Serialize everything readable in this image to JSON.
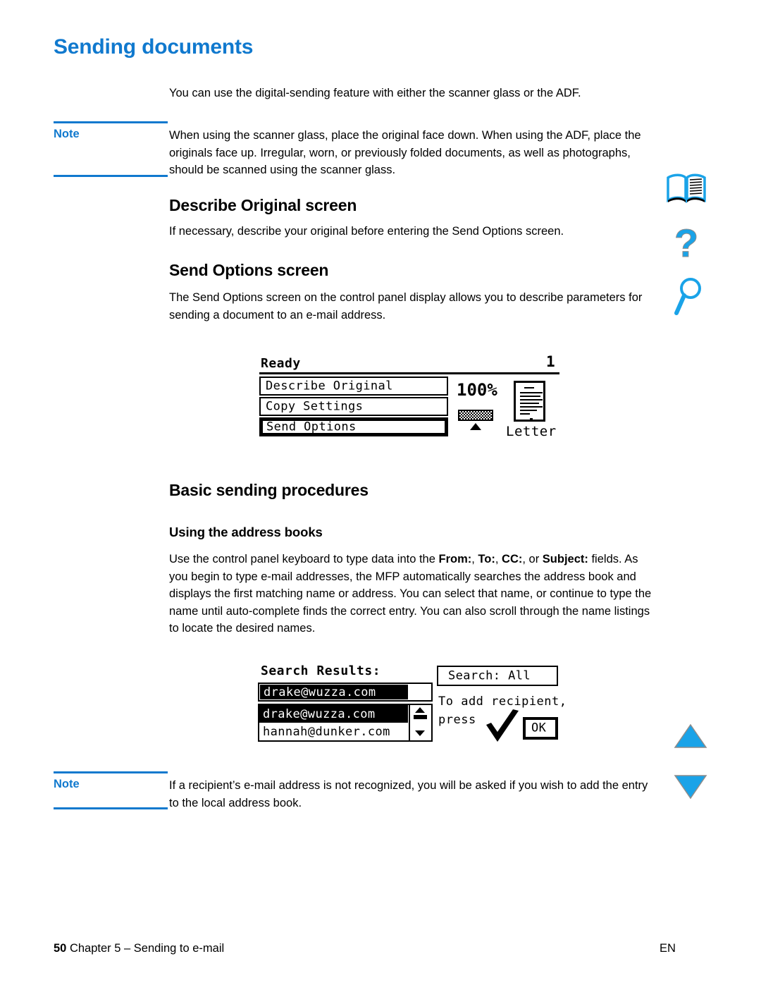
{
  "page": {
    "title": "Sending documents",
    "accent_color": "#1079ce"
  },
  "intro": {
    "paragraph": "You can use the digital-sending feature with either the scanner glass or the ADF."
  },
  "note1": {
    "label": "Note",
    "text": "When using the scanner glass, place the original face down. When using the ADF, place the originals face up. Irregular, worn, or previously folded documents, as well as photographs, should be scanned using the scanner glass."
  },
  "section_describe": {
    "heading": "Describe Original screen",
    "paragraph": "If necessary, describe your original before entering the Send Options screen."
  },
  "section_send_options": {
    "heading": "Send Options screen",
    "paragraph": "The Send Options screen on the control panel display allows you to describe parameters for sending a document to an e-mail address."
  },
  "control_panel_figure": {
    "status": "Ready",
    "copies": "1",
    "menu_items": [
      {
        "label": "Describe Original",
        "selected": false
      },
      {
        "label": "Copy Settings",
        "selected": false
      },
      {
        "label": "Send Options",
        "selected": true
      }
    ],
    "zoom_value": "100%",
    "paper_size": "Letter",
    "density_icon": "density-bar-icon",
    "density_marker_icon": "triangle-up-icon",
    "page_icon": "document-page-icon"
  },
  "section_basic": {
    "heading": "Basic sending procedures",
    "subheading": "Using the address books",
    "paragraph_parts": [
      {
        "t": "Use the control panel keyboard to type data into the ",
        "b": false
      },
      {
        "t": "From:",
        "b": true
      },
      {
        "t": ", ",
        "b": false
      },
      {
        "t": "To:",
        "b": true
      },
      {
        "t": ", ",
        "b": false
      },
      {
        "t": "CC:",
        "b": true
      },
      {
        "t": ", or ",
        "b": false
      },
      {
        "t": "Subject:",
        "b": true
      },
      {
        "t": " fields. As you begin to type e-mail addresses, the MFP automatically searches the address book and displays the first matching name or address. You can select that name, or continue to type the name until auto-complete finds the correct entry. You can also scroll through the name listings to locate the desired names.",
        "b": false
      }
    ]
  },
  "search_figure": {
    "results_label": "Search Results:",
    "entry_value": "drake@wuzza.com",
    "list_items": [
      {
        "value": "drake@wuzza.com",
        "highlighted": true
      },
      {
        "value": "hannah@dunker.com",
        "highlighted": false
      }
    ],
    "search_scope": "Search: All",
    "prompt_line1": "To add recipient,",
    "prompt_line2": "press",
    "checkmark_icon": "checkmark-icon",
    "ok_button": "OK",
    "scroll_up_icon": "scroll-up-arrow-icon",
    "scroll_down_icon": "scroll-down-arrow-icon",
    "scroll_thumb_icon": "scrollbar-thumb"
  },
  "note2": {
    "label": "Note",
    "text": "If a recipient’s e-mail address is not recognized, you will be asked if you wish to add the entry to the local address book."
  },
  "nav_icons": [
    {
      "name": "index-book-icon"
    },
    {
      "name": "help-question-icon"
    },
    {
      "name": "search-magnifier-icon"
    },
    {
      "name": "previous-page-triangle-icon"
    },
    {
      "name": "next-page-triangle-icon"
    }
  ],
  "footer": {
    "page_number": "50",
    "chapter": "Chapter 5 – Sending to e-mail",
    "language": "EN"
  }
}
